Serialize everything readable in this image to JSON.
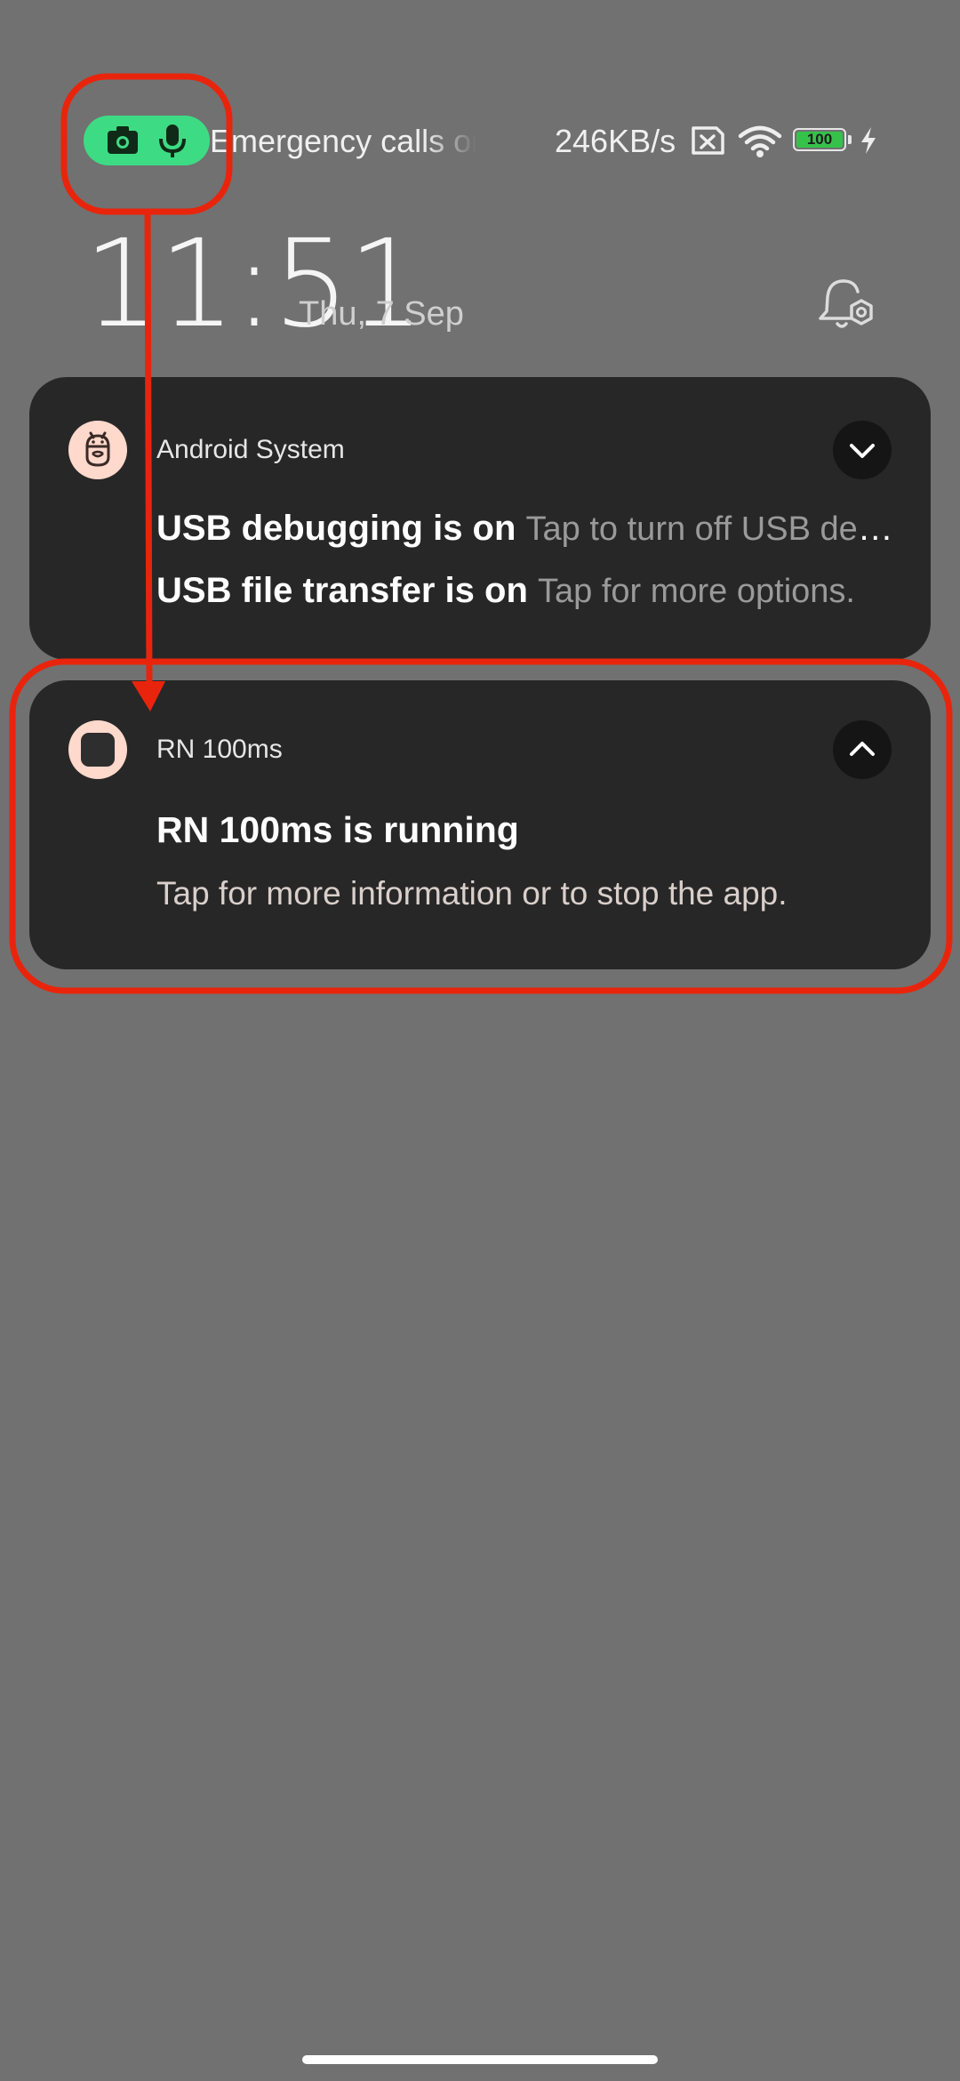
{
  "status_bar": {
    "carrier_text": "Emergency calls only",
    "network_speed": "246KB/s",
    "battery_level": "100",
    "privacy_indicators": [
      "camera-icon",
      "mic-icon"
    ],
    "icons": [
      "nosim-icon",
      "wifi-icon",
      "battery-icon",
      "charging-icon"
    ],
    "privacy_color": "#3ddc84"
  },
  "clock": {
    "time": "11:51",
    "date": "Thu, 7 Sep"
  },
  "notifications": [
    {
      "app_name": "Android System",
      "expanded": false,
      "lines": [
        {
          "title": "USB debugging is on",
          "text": "Tap to turn off USB debugging."
        },
        {
          "title": "USB file transfer is on",
          "text": "Tap for more options."
        }
      ]
    },
    {
      "app_name": "RN 100ms",
      "expanded": true,
      "title": "RN 100ms is running",
      "text": "Tap for more information or to stop the app."
    }
  ],
  "colors": {
    "background": "#717171",
    "card": "#272727",
    "annotation": "#e8250c"
  }
}
